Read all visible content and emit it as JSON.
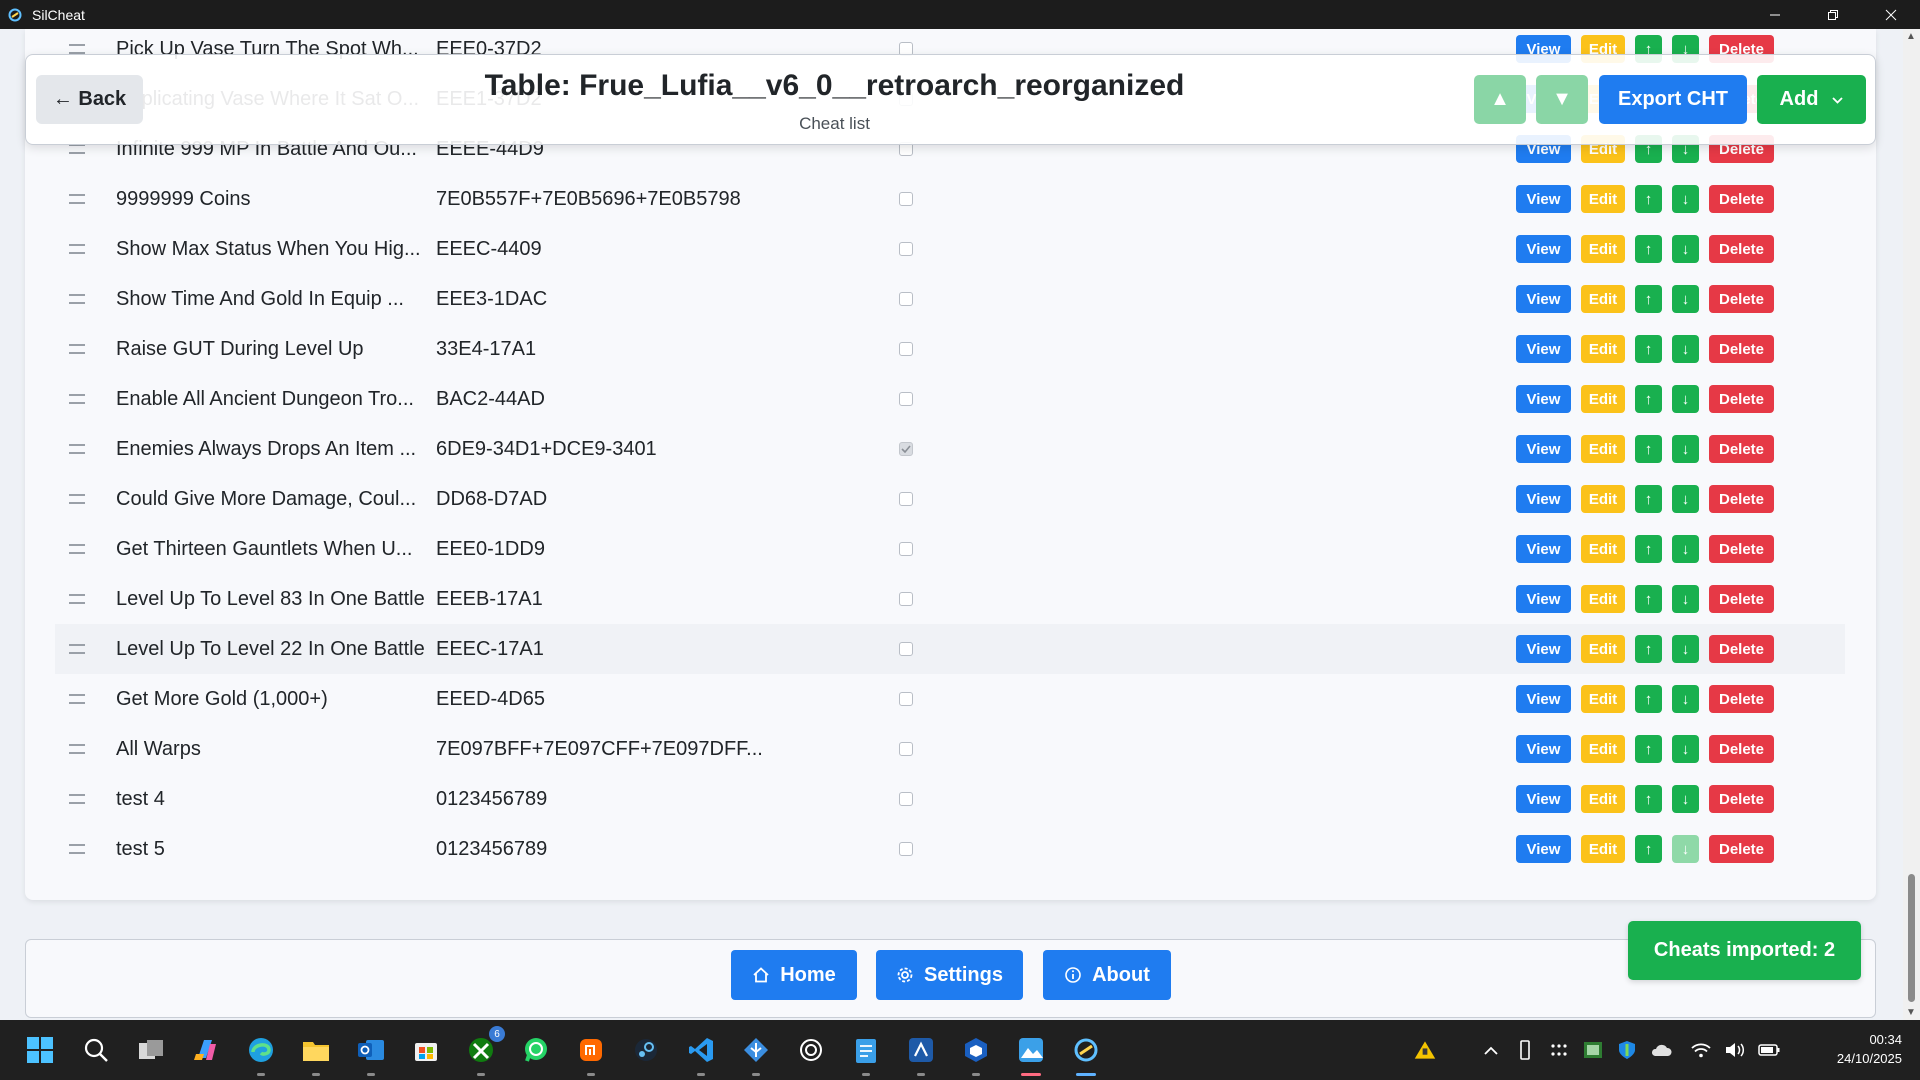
{
  "window": {
    "title": "SilCheat"
  },
  "header": {
    "back_label": "← Back",
    "title": "Table: Frue_Lufia__v6_0__retroarch_reorganized",
    "subtitle": "Cheat list",
    "move_up_glyph": "▲",
    "move_down_glyph": "▼",
    "export_label": "Export CHT",
    "add_label": "Add"
  },
  "row_actions": {
    "view": "View",
    "edit": "Edit",
    "up": "↑",
    "down": "↓",
    "delete": "Delete"
  },
  "cheats": [
    {
      "name": "Pick Up Vase Turn The Spot Wh...",
      "code": "EEE0-37D2",
      "enabled": false
    },
    {
      "name": "Duplicating Vase Where It Sat O...",
      "code": "EEE1-37D2",
      "enabled": false
    },
    {
      "name": "Infinite 999 MP In Battle And Ou...",
      "code": "EEEE-44D9",
      "enabled": false
    },
    {
      "name": "9999999 Coins",
      "code": "7E0B557F+7E0B5696+7E0B5798",
      "enabled": false
    },
    {
      "name": "Show Max Status When You Hig...",
      "code": "EEEC-4409",
      "enabled": false
    },
    {
      "name": "Show Time And Gold In Equip ...",
      "code": "EEE3-1DAC",
      "enabled": false
    },
    {
      "name": "Raise GUT During Level Up",
      "code": "33E4-17A1",
      "enabled": false
    },
    {
      "name": "Enable All Ancient Dungeon Tro...",
      "code": "BAC2-44AD",
      "enabled": false
    },
    {
      "name": "Enemies Always Drops An Item ...",
      "code": "6DE9-34D1+DCE9-3401",
      "enabled": true
    },
    {
      "name": "Could Give More Damage, Coul...",
      "code": "DD68-D7AD",
      "enabled": false
    },
    {
      "name": "Get Thirteen Gauntlets When U...",
      "code": "EEE0-1DD9",
      "enabled": false
    },
    {
      "name": "Level Up To Level 83 In One Battle",
      "code": "EEEB-17A1",
      "enabled": false
    },
    {
      "name": "Level Up To Level 22 In One Battle",
      "code": "EEEC-17A1",
      "enabled": false
    },
    {
      "name": "Get More Gold (1,000+)",
      "code": "EEED-4D65",
      "enabled": false
    },
    {
      "name": "All Warps",
      "code": "7E097BFF+7E097CFF+7E097DFF...",
      "enabled": false
    },
    {
      "name": "test 4",
      "code": "0123456789",
      "enabled": false
    },
    {
      "name": "test 5",
      "code": "0123456789",
      "enabled": false
    }
  ],
  "footer": {
    "home_label": "Home",
    "settings_label": "Settings",
    "about_label": "About"
  },
  "toast": {
    "message": "Cheats imported: 2"
  },
  "taskbar": {
    "xbox_badge": "6",
    "clock_time": "00:34",
    "clock_date": "24/10/2025"
  },
  "colors": {
    "primary": "#1f7cf0",
    "success": "#19b04f",
    "warning": "#fbc21a",
    "danger": "#e63946",
    "title_bar": "#1c1c1c",
    "taskbar": "#202020"
  }
}
